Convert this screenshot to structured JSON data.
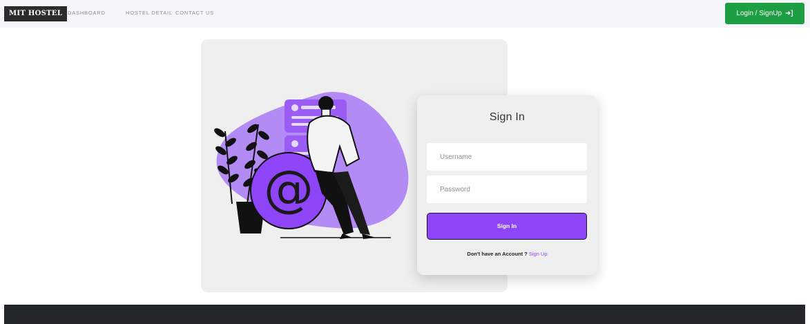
{
  "navbar": {
    "brand": "MIT HOSTEL",
    "links": [
      "DASHBOARD",
      "HOSTEL DETAIL",
      "CONTACT US"
    ],
    "login_button": "Login / SignUp",
    "login_icon": "sign-in-icon"
  },
  "illustration": {
    "symbol": "@"
  },
  "signin": {
    "title": "Sign In",
    "username_placeholder": "Username",
    "password_placeholder": "Password",
    "button": "Sign In",
    "no_account_text": "Don't have an Account ?",
    "signup_link": "Sign Up"
  },
  "colors": {
    "accent": "#8e44f7",
    "login_green": "#1e9e43",
    "footer": "#23262b",
    "panel": "#efefef"
  }
}
